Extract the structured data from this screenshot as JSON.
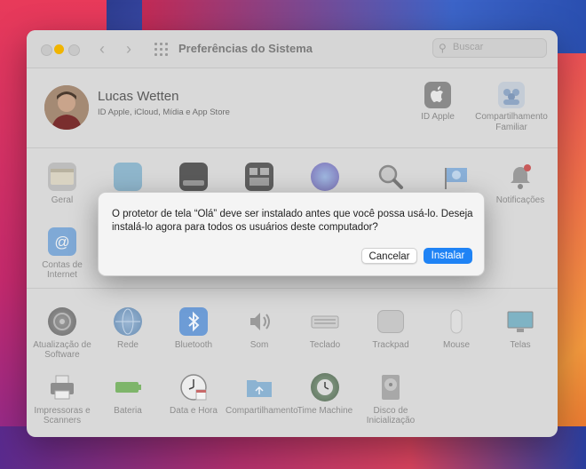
{
  "window": {
    "title": "Preferências do Sistema",
    "search_placeholder": "Buscar"
  },
  "user": {
    "name": "Lucas Wetten",
    "subtitle": "ID Apple, iCloud, Mídia e App Store"
  },
  "account_items": [
    {
      "label": "ID Apple",
      "icon": "apple-icon"
    },
    {
      "label": "Compartilhamento Familiar",
      "icon": "family-sharing-icon"
    }
  ],
  "row1": [
    {
      "label": "Geral",
      "icon": "general-icon"
    },
    {
      "label": "",
      "icon": "desktop-icon"
    },
    {
      "label": "",
      "icon": "dock-icon"
    },
    {
      "label": "",
      "icon": "mission-control-icon"
    },
    {
      "label": "",
      "icon": "siri-icon"
    },
    {
      "label": "",
      "icon": "spotlight-icon"
    },
    {
      "label": "",
      "icon": "language-icon"
    },
    {
      "label": "Notificações",
      "icon": "notifications-icon"
    }
  ],
  "row2": [
    {
      "label": "Contas de Internet",
      "icon": "internet-accounts-icon"
    }
  ],
  "row3": [
    {
      "label": "Atualização de Software",
      "icon": "software-update-icon"
    },
    {
      "label": "Rede",
      "icon": "network-icon"
    },
    {
      "label": "Bluetooth",
      "icon": "bluetooth-icon"
    },
    {
      "label": "Som",
      "icon": "sound-icon"
    },
    {
      "label": "Teclado",
      "icon": "keyboard-icon"
    },
    {
      "label": "Trackpad",
      "icon": "trackpad-icon"
    },
    {
      "label": "Mouse",
      "icon": "mouse-icon"
    },
    {
      "label": "Telas",
      "icon": "displays-icon"
    }
  ],
  "row4": [
    {
      "label": "Impressoras e Scanners",
      "icon": "printer-icon"
    },
    {
      "label": "Bateria",
      "icon": "battery-icon"
    },
    {
      "label": "Data e Hora",
      "icon": "clock-icon"
    },
    {
      "label": "Compartilhamento",
      "icon": "sharing-folder-icon"
    },
    {
      "label": "Time Machine",
      "icon": "time-machine-icon"
    },
    {
      "label": "Disco de Inicialização",
      "icon": "startup-disk-icon"
    }
  ],
  "dialog": {
    "message": "O protetor de tela “Olá” deve ser instalado antes que você possa usá-lo. Deseja instalá-lo agora para todos os usuários deste computador?",
    "cancel_label": "Cancelar",
    "install_label": "Instalar"
  },
  "colors": {
    "accent": "#1f83f5",
    "minimize": "#f0b400"
  }
}
